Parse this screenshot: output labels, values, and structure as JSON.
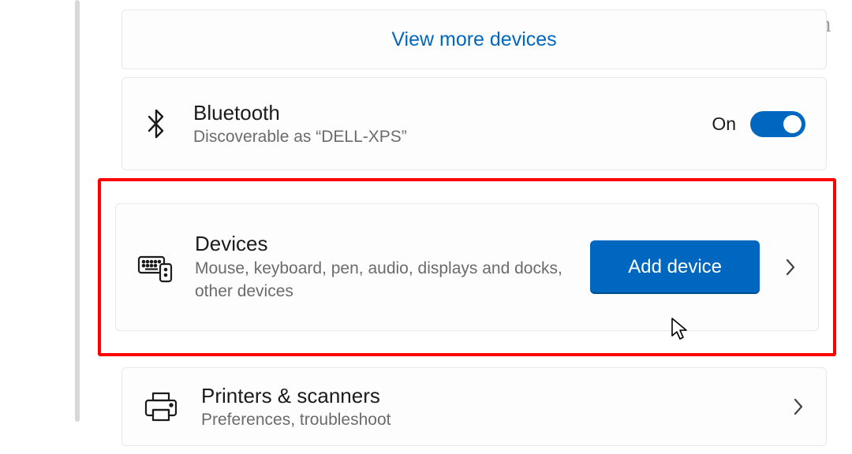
{
  "watermark": "groovyPost.com",
  "view_more": {
    "label": "View more devices"
  },
  "bluetooth": {
    "title": "Bluetooth",
    "subtitle": "Discoverable as “DELL-XPS”",
    "state_label": "On"
  },
  "devices": {
    "title": "Devices",
    "subtitle": "Mouse, keyboard, pen, audio, displays and docks, other devices",
    "add_button": "Add device"
  },
  "printers": {
    "title": "Printers & scanners",
    "subtitle": "Preferences, troubleshoot"
  }
}
